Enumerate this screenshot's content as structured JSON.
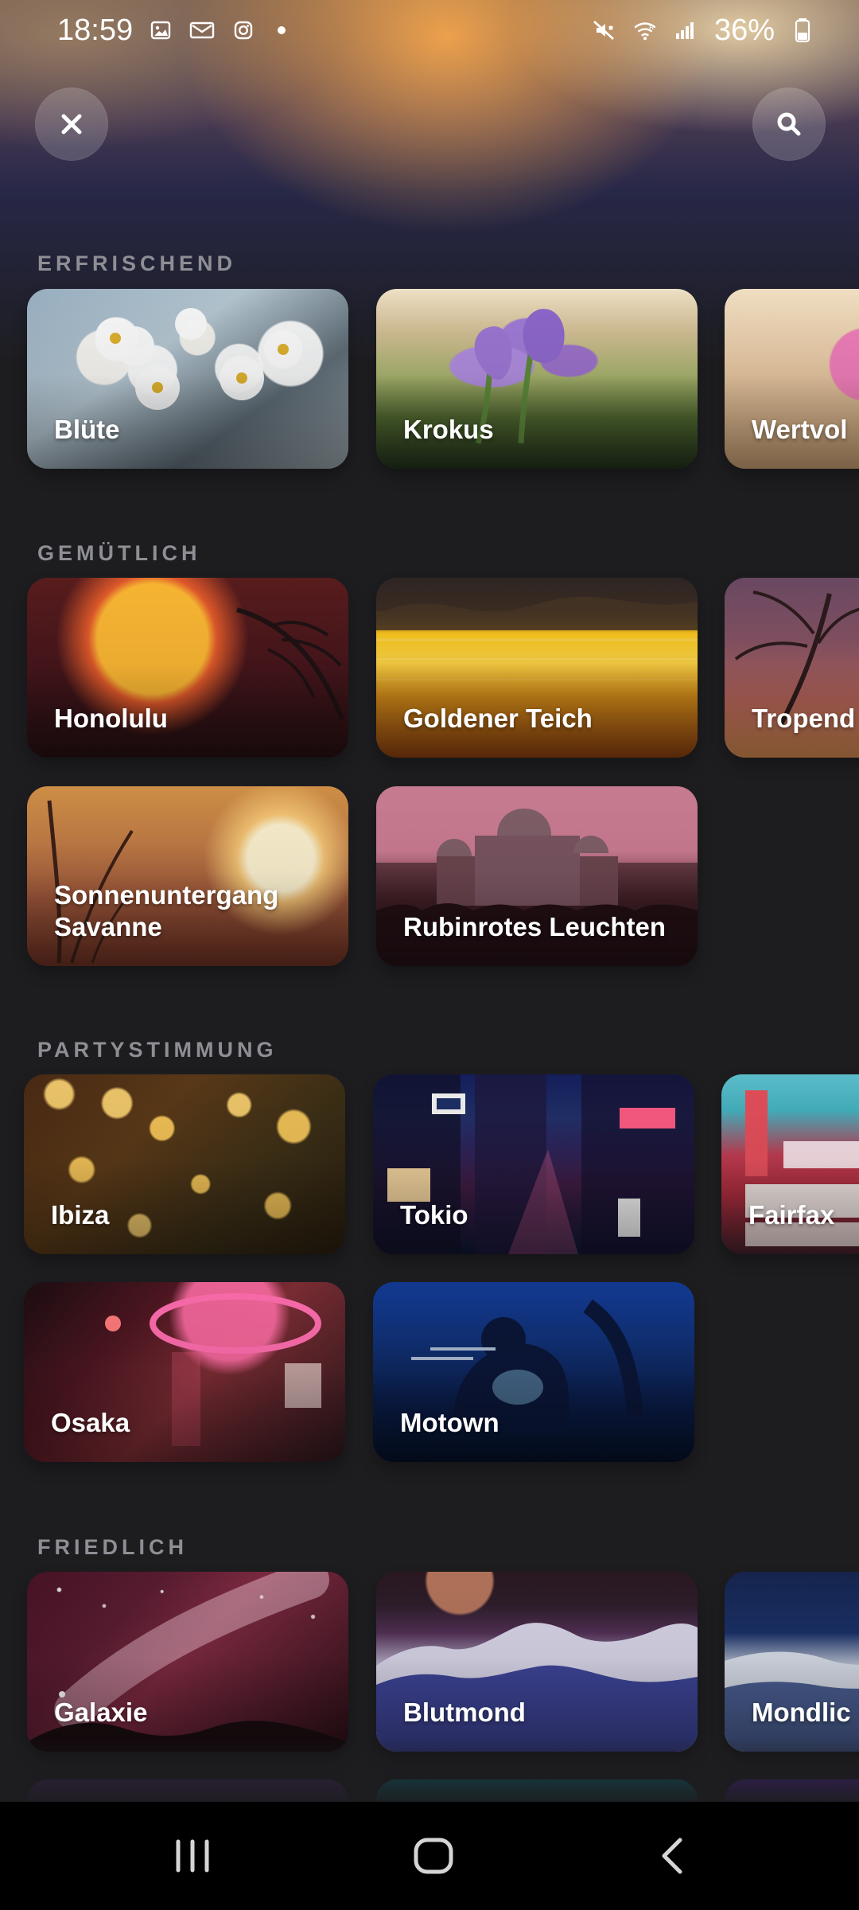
{
  "status": {
    "time": "18:59",
    "battery": "36%",
    "notifications": [
      "image-icon",
      "mail-icon",
      "instagram-icon",
      "dot-icon"
    ],
    "system": [
      "mute-icon",
      "wifi-icon",
      "signal-icon",
      "battery-icon"
    ]
  },
  "header": {
    "close_icon": "close-icon",
    "search_icon": "search-icon"
  },
  "sections": {
    "erfrischend": {
      "title": "ERFRISCHEND",
      "cards": [
        "Blüte",
        "Krokus",
        "Wertvol"
      ]
    },
    "gemuetlich": {
      "title": "GEMÜTLICH",
      "cards": [
        "Honolulu",
        "Goldener Teich",
        "Tropend",
        "Sonnenuntergang\nSavanne",
        "Rubinrotes Leuchten"
      ]
    },
    "partystimmung": {
      "title": "PARTYSTIMMUNG",
      "cards": [
        "Ibiza",
        "Tokio",
        "Fairfax",
        "Osaka",
        "Motown"
      ]
    },
    "friedlich": {
      "title": "FRIEDLICH",
      "cards": [
        "Galaxie",
        "Blutmond",
        "Mondlic"
      ]
    }
  },
  "navigation": {
    "menu_icon": "recent-apps-icon",
    "home_icon": "home-icon",
    "back_icon": "back-icon"
  }
}
